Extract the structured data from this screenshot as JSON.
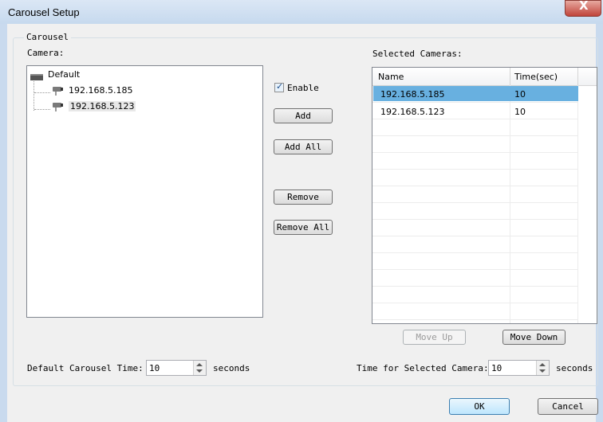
{
  "window": {
    "title": "Carousel Setup",
    "close_glyph": "X"
  },
  "group": {
    "label": "Carousel"
  },
  "camera_label": "Camera:",
  "tree": {
    "root": "Default",
    "children": [
      "192.168.5.185",
      "192.168.5.123"
    ],
    "selected_index": 1
  },
  "enable": {
    "label": "Enable",
    "checked": true
  },
  "buttons": {
    "add": "Add",
    "add_all": "Add All",
    "remove": "Remove",
    "remove_all": "Remove All",
    "move_up": "Move Up",
    "move_down": "Move Down",
    "ok": "OK",
    "cancel": "Cancel"
  },
  "selected_cameras": {
    "label": "Selected Cameras:",
    "columns": [
      "Name",
      "Time(sec)"
    ],
    "rows": [
      {
        "name": "192.168.5.185",
        "time": "10"
      },
      {
        "name": "192.168.5.123",
        "time": "10"
      }
    ],
    "selected_row": 0
  },
  "default_time": {
    "label": "Default Carousel Time:",
    "value": "10",
    "unit": "seconds"
  },
  "selected_time": {
    "label": "Time for Selected Camera:",
    "value": "10",
    "unit": "seconds"
  },
  "colors": {
    "selection": "#68b0e0",
    "title_bar": "#c6d9ee",
    "close_button": "#c0443a"
  }
}
